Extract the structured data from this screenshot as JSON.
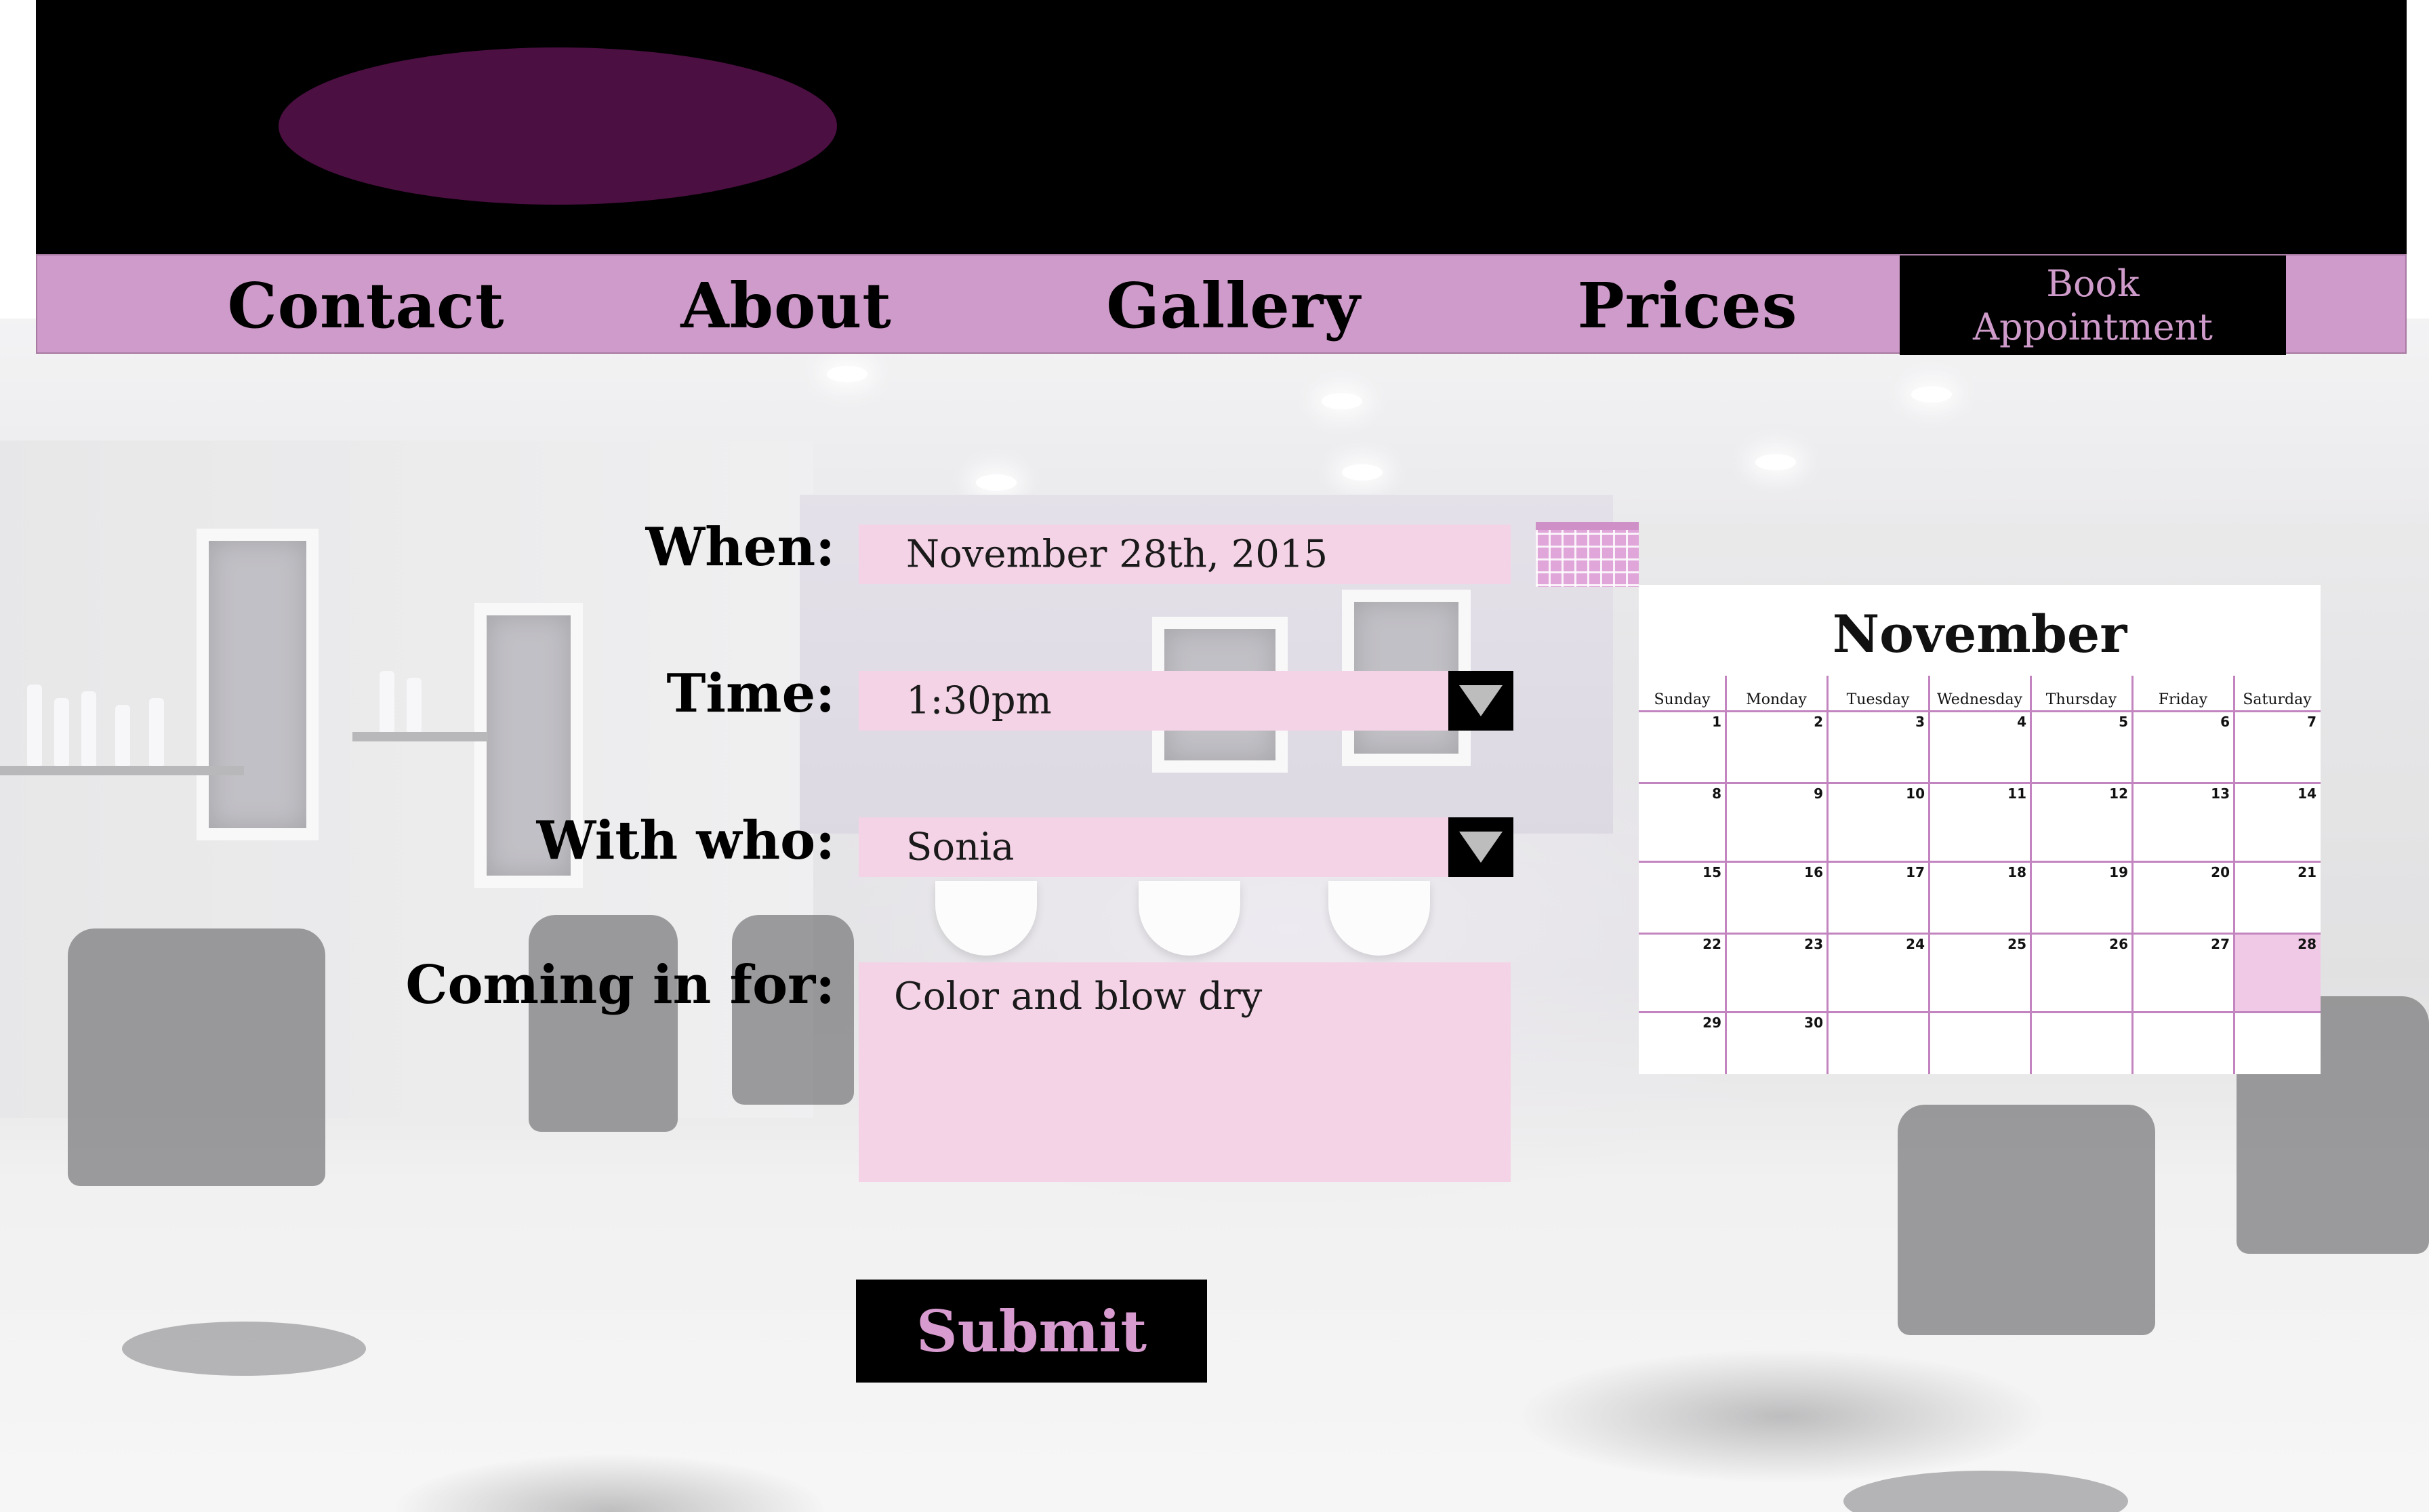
{
  "nav": {
    "items": [
      "Contact",
      "About",
      "Gallery",
      "Prices"
    ],
    "book_line1": "Book",
    "book_line2": "Appointment"
  },
  "form": {
    "when_label": "When:",
    "when_value": "November 28th, 2015",
    "time_label": "Time:",
    "time_value": "1:30pm",
    "who_label": "With who:",
    "who_value": "Sonia",
    "for_label": "Coming in for:",
    "for_value": "Color and blow dry",
    "submit_label": "Submit"
  },
  "calendar": {
    "month": "November",
    "weekdays": [
      "Sunday",
      "Monday",
      "Tuesday",
      "Wednesday",
      "Thursday",
      "Friday",
      "Saturday"
    ],
    "weeks": [
      [
        "1",
        "2",
        "3",
        "4",
        "5",
        "6",
        "7"
      ],
      [
        "8",
        "9",
        "10",
        "11",
        "12",
        "13",
        "14"
      ],
      [
        "15",
        "16",
        "17",
        "18",
        "19",
        "20",
        "21"
      ],
      [
        "22",
        "23",
        "24",
        "25",
        "26",
        "27",
        "28"
      ],
      [
        "29",
        "30",
        "",
        "",
        "",
        "",
        ""
      ]
    ],
    "selected_day": "28"
  },
  "colors": {
    "brand_pink": "#cf9bca",
    "logo_purple": "#4b0f42",
    "field_pink": "#f4d3e6",
    "header_black": "#000000"
  },
  "icons": [
    "calendar-icon",
    "dropdown-arrow-icon"
  ]
}
